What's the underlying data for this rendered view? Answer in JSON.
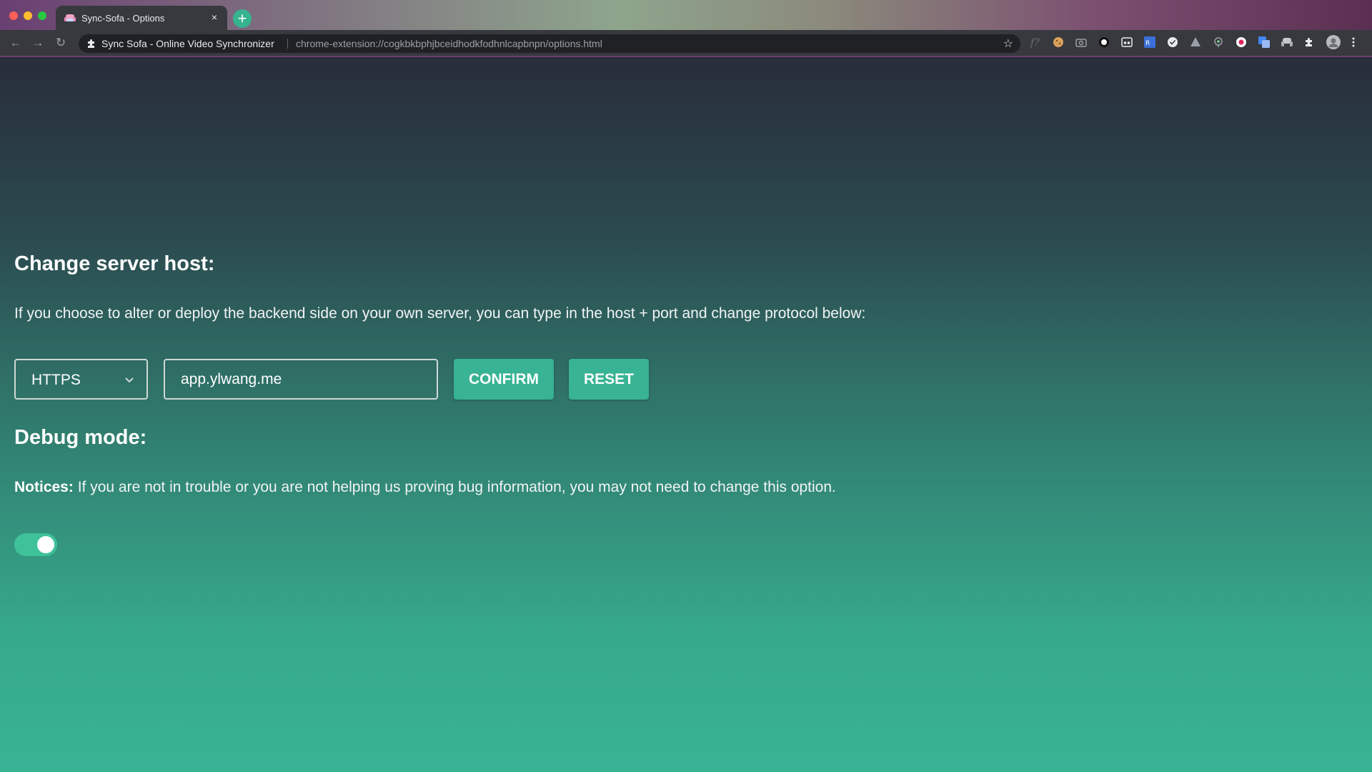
{
  "browser": {
    "tab_title": "Sync-Sofa - Options",
    "tab_close": "×",
    "new_tab": "+",
    "site_name": "Sync Sofa - Online Video Synchronizer",
    "url": "chrome-extension://cogkbkbphjbceidhodkfodhnlcapbnpn/options.html",
    "accent_color": "#38b393"
  },
  "server": {
    "heading": "Change server host:",
    "description": "If you choose to alter or deploy the backend side on your own server, you can type in the host + port and change protocol below:",
    "protocol_selected": "HTTPS",
    "host_value": "app.ylwang.me",
    "confirm_label": "CONFIRM",
    "reset_label": "RESET"
  },
  "debug": {
    "heading": "Debug mode:",
    "notice_label": "Notices:",
    "notice_text": " If you are not in trouble or you are not helping us proving bug information, you may not need to change this option.",
    "enabled": true
  }
}
